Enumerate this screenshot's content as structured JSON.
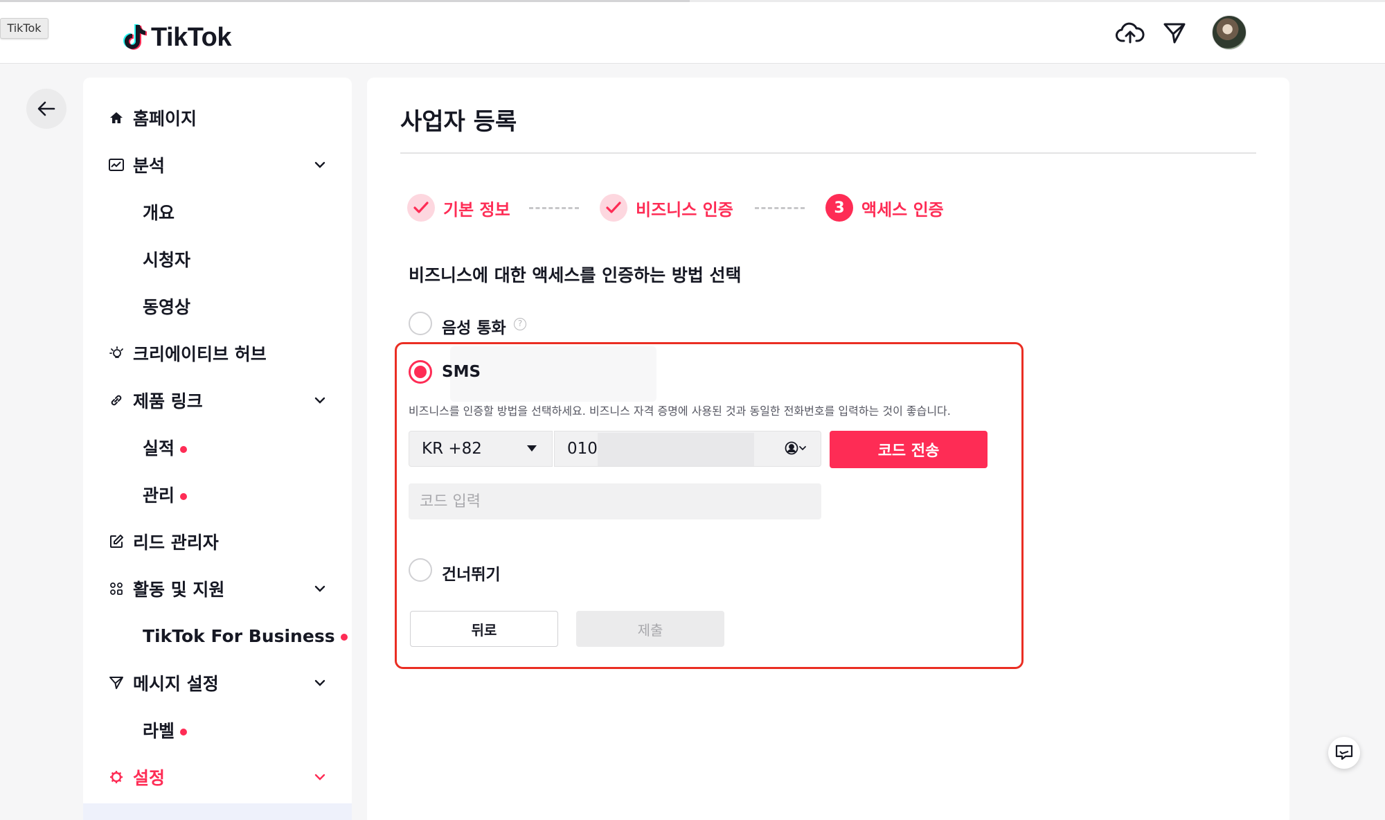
{
  "browser": {
    "tab_tooltip": "TikTok"
  },
  "header": {
    "logo_text": "TikTok",
    "upload_icon": "cloud-upload-icon",
    "inbox_icon": "send-icon",
    "avatar": "user-avatar"
  },
  "sidebar": {
    "items": [
      {
        "label": "홈페이지",
        "icon": "home-icon"
      },
      {
        "label": "분석",
        "icon": "analytics-icon",
        "expandable": true
      },
      {
        "label": "개요"
      },
      {
        "label": "시청자"
      },
      {
        "label": "동영상"
      },
      {
        "label": "크리에이티브 허브",
        "icon": "lightbulb-icon"
      },
      {
        "label": "제품 링크",
        "icon": "link-icon",
        "expandable": true
      },
      {
        "label": "실적",
        "dot": true
      },
      {
        "label": "관리",
        "dot": true
      },
      {
        "label": "리드 관리자",
        "icon": "edit-icon"
      },
      {
        "label": "활동 및 지원",
        "icon": "apps-icon",
        "expandable": true
      },
      {
        "label": "TikTok For Business",
        "dot": true
      },
      {
        "label": "메시지 설정",
        "icon": "send-icon",
        "expandable": true
      },
      {
        "label": "라벨",
        "dot": true
      },
      {
        "label": "설정",
        "icon": "gear-icon",
        "expandable": true,
        "active": true
      }
    ]
  },
  "main": {
    "title": "사업자 등록",
    "steps": [
      {
        "label": "기본 정보",
        "state": "done"
      },
      {
        "label": "비즈니스 인증",
        "state": "done"
      },
      {
        "number": "3",
        "label": "액세스 인증",
        "state": "current"
      }
    ],
    "question": "비즈니스에 대한 액세스를 인증하는 방법 선택",
    "options": {
      "voice": {
        "label": "음성 통화",
        "help": "?"
      },
      "sms": {
        "label": "SMS",
        "selected": true
      },
      "skip": {
        "label": "건너뛰기"
      }
    },
    "hint": "비즈니스를 인증할 방법을 선택하세요. 비즈니스 자격 증명에 사용된 것과 동일한 전화번호를 입력하는 것이 좋습니다.",
    "country_code": "KR +82",
    "phone_value": "010",
    "send_code_label": "코드 전송",
    "code_placeholder": "코드 입력",
    "back_label": "뒤로",
    "submit_label": "제출"
  },
  "colors": {
    "accent": "#fe2c55",
    "highlight_border": "#ea2e23"
  }
}
